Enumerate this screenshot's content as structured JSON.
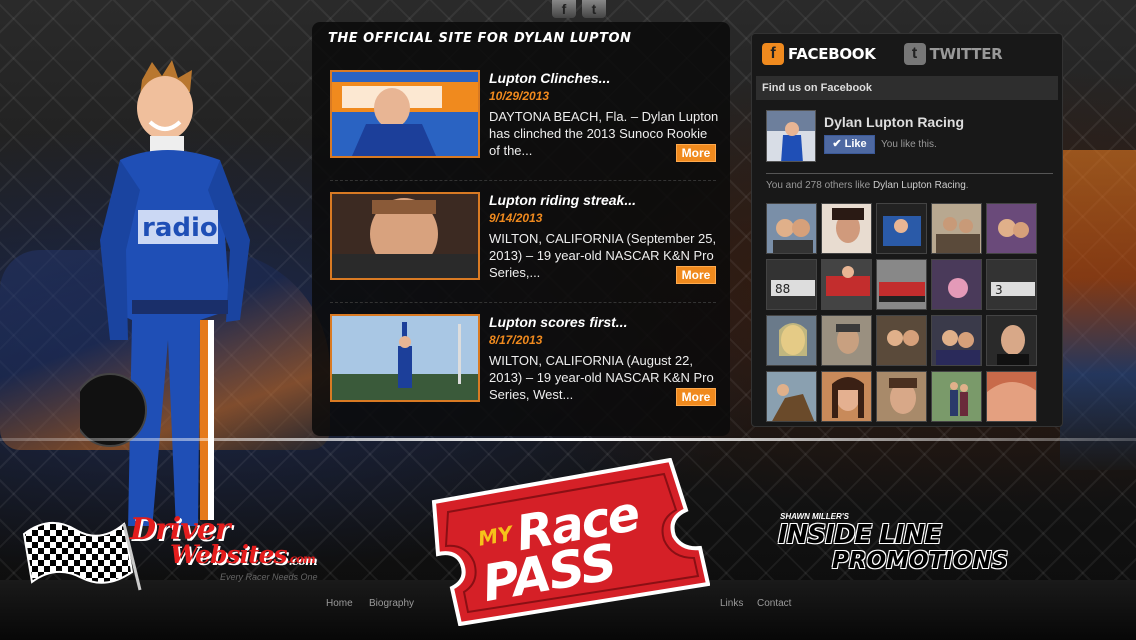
{
  "top_social": {
    "facebook_glyph": "f",
    "twitter_glyph": "t"
  },
  "site_title": "THE OFFICIAL SITE FOR DYLAN LUPTON",
  "news": [
    {
      "headline": "Lupton Clinches...",
      "date": "10/29/2013",
      "excerpt": "DAYTONA BEACH, Fla. – Dylan Lupton has clinched the 2013 Sunoco Rookie of the...",
      "more_label": "More"
    },
    {
      "headline": "Lupton riding streak...",
      "date": "9/14/2013",
      "excerpt": "WILTON, CALIFORNIA (September 25, 2013) – 19 year-old NASCAR K&N Pro Series,...",
      "more_label": "More"
    },
    {
      "headline": "Lupton scores first...",
      "date": "8/17/2013",
      "excerpt": "WILTON, CALIFORNIA (August 22, 2013) – 19 year-old NASCAR K&N Pro Series, West...",
      "more_label": "More"
    }
  ],
  "social_panel": {
    "tabs": [
      {
        "label": "FACEBOOK",
        "glyph": "f",
        "active": true
      },
      {
        "label": "TWITTER",
        "glyph": "t",
        "active": false
      }
    ],
    "find_us": "Find us on Facebook",
    "page_name": "Dylan Lupton Racing",
    "like_label": "Like",
    "you_like": "You like this.",
    "count_prefix": "You and 278 others like ",
    "count_link": "Dylan Lupton Racing",
    "count_suffix": "."
  },
  "logos": {
    "driver_websites_1": "Driver",
    "driver_websites_2": "Websites",
    "driver_websites_com": ".com",
    "driver_websites_tag": "Every Racer Needs One",
    "mrp_my": "MY",
    "mrp_race": "Race",
    "mrp_pass": "PASS",
    "ilp_small": "SHAWN MILLER'S",
    "ilp_main": "INSIDE LINE",
    "ilp_sub": "PROMOTIONS"
  },
  "footer_nav": [
    "Home",
    "Biography",
    "Links",
    "Contact"
  ],
  "colors": {
    "accent": "#f08a1e",
    "fb_blue": "#4e69a2",
    "logo_red": "#e41d1d"
  }
}
